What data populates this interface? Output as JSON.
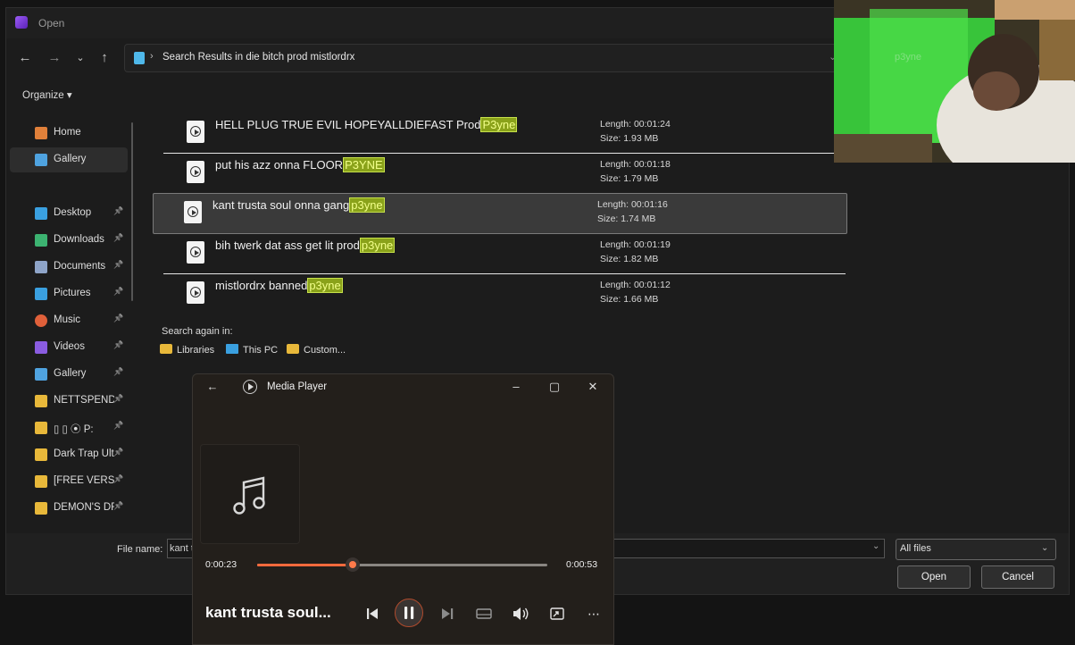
{
  "dialog": {
    "title": "Open",
    "breadcrumb": "Search Results in die bitch prod mistlordrx",
    "organize_label": "Organize ▾",
    "search_box_text": "p3yne"
  },
  "sidebar": {
    "items": [
      {
        "label": "Home",
        "icon": "home-icon",
        "color": "#e0803a",
        "pinned": false,
        "selected": false
      },
      {
        "label": "Gallery",
        "icon": "gallery-icon",
        "color": "#4fa3e0",
        "pinned": false,
        "selected": true
      },
      {
        "label": "Desktop",
        "icon": "desktop-icon",
        "color": "#3aa0e0",
        "pinned": true,
        "selected": false
      },
      {
        "label": "Downloads",
        "icon": "download-icon",
        "color": "#3cb371",
        "pinned": true,
        "selected": false
      },
      {
        "label": "Documents",
        "icon": "documents-icon",
        "color": "#8ea4c8",
        "pinned": true,
        "selected": false
      },
      {
        "label": "Pictures",
        "icon": "pictures-icon",
        "color": "#3aa0e0",
        "pinned": true,
        "selected": false
      },
      {
        "label": "Music",
        "icon": "music-icon",
        "color": "#e0603a",
        "pinned": true,
        "selected": false
      },
      {
        "label": "Videos",
        "icon": "videos-icon",
        "color": "#8a5ce0",
        "pinned": true,
        "selected": false
      },
      {
        "label": "Gallery",
        "icon": "gallery-icon",
        "color": "#4fa3e0",
        "pinned": true,
        "selected": false
      },
      {
        "label": "NETTSPEND",
        "icon": "folder-icon",
        "color": "#e8b83a",
        "pinned": true,
        "selected": false
      },
      {
        "label": "▯ ▯ ⦿ P:",
        "icon": "folder-icon",
        "color": "#e8b83a",
        "pinned": true,
        "selected": false
      },
      {
        "label": "Dark Trap Ult",
        "icon": "folder-icon",
        "color": "#e8b83a",
        "pinned": true,
        "selected": false
      },
      {
        "label": "[FREE VERSIC",
        "icon": "folder-icon",
        "color": "#e8b83a",
        "pinned": true,
        "selected": false
      },
      {
        "label": "DEMON'S DF",
        "icon": "folder-icon",
        "color": "#e8b83a",
        "pinned": true,
        "selected": false
      }
    ]
  },
  "results": {
    "rows": [
      {
        "name": "HELL PLUG TRUE EVIL HOPEYALLDIEFAST Prod",
        "match": "P3yne",
        "length": "Length: 00:01:24",
        "size": "Size: 1.93 MB"
      },
      {
        "name": "put his azz onna FLOOR",
        "match": "P3YNE",
        "length": "Length: 00:01:18",
        "size": "Size: 1.79 MB"
      },
      {
        "name": "kant trusta soul onna gang",
        "match": "p3yne",
        "length": "Length: 00:01:16",
        "size": "Size: 1.74 MB"
      },
      {
        "name": "bih twerk dat ass get lit prod",
        "match": "p3yne",
        "length": "Length: 00:01:19",
        "size": "Size: 1.82 MB"
      },
      {
        "name": "mistlordrx banned",
        "match": "p3yne",
        "length": "Length: 00:01:12",
        "size": "Size: 1.66 MB"
      }
    ],
    "selected_index": 2
  },
  "search_again": {
    "label": "Search again in:",
    "links": [
      "Libraries",
      "This PC",
      "Custom..."
    ]
  },
  "bottom": {
    "filename_label": "File name:",
    "filename_value": "kant t",
    "filetype": "All files",
    "open_label": "Open",
    "cancel_label": "Cancel"
  },
  "media_player": {
    "title": "Media Player",
    "current_time": "0:00:23",
    "duration": "0:00:53",
    "progress": 0.33,
    "now_playing": "kant trusta soul...",
    "accent": "#ff6a3d"
  }
}
